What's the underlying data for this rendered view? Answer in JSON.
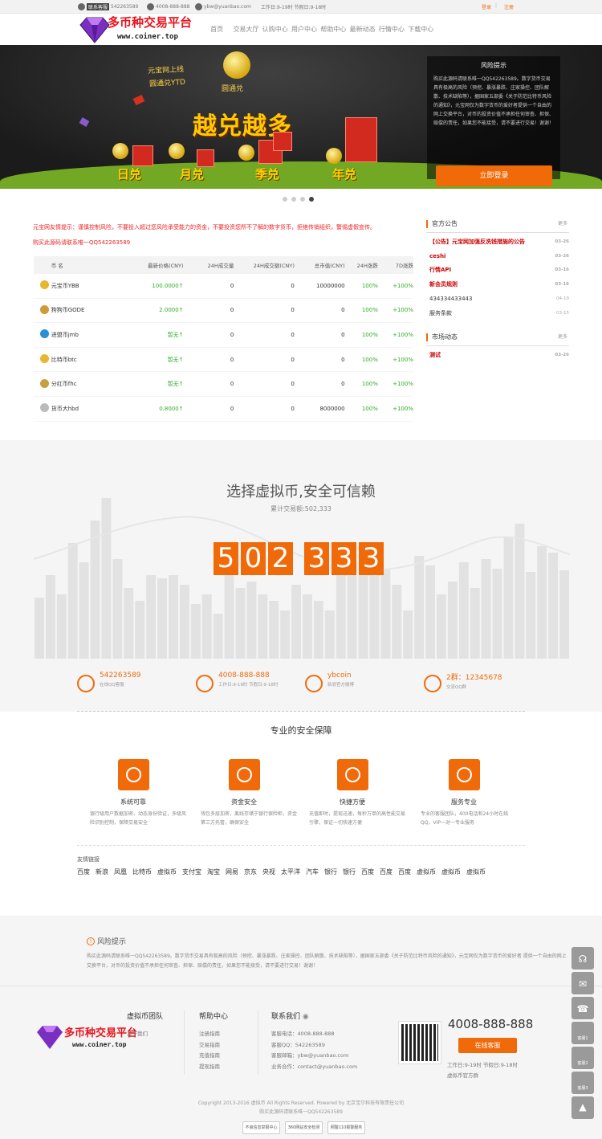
{
  "topbar": {
    "service": "联系客服",
    "qq": "542263589",
    "phone": "4008-888-888",
    "email": "ybw@yuanbao.com",
    "hours": "工作日:9-19时 节假日:9-18时",
    "login": "登录",
    "register": "注册"
  },
  "header": {
    "logo_text": "多币种交易平台",
    "logo_url": "www.coiner.top",
    "nav": [
      "首页",
      "交易大厅",
      "认购中心",
      "用户中心",
      "帮助中心",
      "最新动态",
      "行情中心",
      "下载中心"
    ]
  },
  "banner": {
    "line1": "元宝网上线",
    "line2": "圆通兑YTD",
    "coin_label": "圆通兑",
    "slogan": "越兑越多",
    "words": [
      "日兑",
      "月兑",
      "季兑",
      "年兑"
    ],
    "risk_title": "风险提示",
    "risk_text": "购买此源码请联系唯一QQ542263589。数字货币交易具有极高的风险（预挖、暴涨暴跌、庄家操控、团队解散、技术缺陷等），据国家五部委《关于防范比特币风险的通知》，元宝网仅为数字货币的爱好者提供一个自由的网上交换平台，对币的投资价值不承担任何审查、担保、赔偿的责任，如果您不能接受，请不要进行交易！谢谢！",
    "login": "立即登录"
  },
  "notice": {
    "text": "元宝网友情提示：谨慎控制风险，不要投入超过您风险承受能力的资金，不要投资您所不了解的数字货币，拒绝传销组织，警惕虚假宣传。",
    "contact": "购买此源码请联系唯一QQ542263589"
  },
  "market": {
    "headers": [
      "币 名",
      "最新价格(CNY)",
      "24H成交量",
      "24H成交额(CNY)",
      "总市值(CNY)",
      "24H涨跌",
      "7D涨跌"
    ],
    "rows": [
      {
        "name": "元宝币YBB",
        "price": "100.0000↑",
        "vol": "0",
        "amt": "0",
        "cap": "10000000",
        "d24": "100%",
        "d7": "+100%",
        "color": "#e8b730"
      },
      {
        "name": "狗狗币GODE",
        "price": "2.0000↑",
        "vol": "0",
        "amt": "0",
        "cap": "0",
        "d24": "100%",
        "d7": "+100%",
        "color": "#d09a3a"
      },
      {
        "name": "进盟币jmb",
        "price": "暂无↑",
        "vol": "0",
        "amt": "0",
        "cap": "0",
        "d24": "100%",
        "d7": "+100%",
        "color": "#2b8fd3"
      },
      {
        "name": "比特币btc",
        "price": "暂无↑",
        "vol": "0",
        "amt": "0",
        "cap": "0",
        "d24": "100%",
        "d7": "+100%",
        "color": "#e8b730"
      },
      {
        "name": "分红币fhc",
        "price": "暂无↑",
        "vol": "0",
        "amt": "0",
        "cap": "0",
        "d24": "100%",
        "d7": "+100%",
        "color": "#c9a040"
      },
      {
        "name": "货币大hbd",
        "price": "0.8000↑",
        "vol": "0",
        "amt": "0",
        "cap": "8000000",
        "d24": "100%",
        "d7": "+100%",
        "color": "#bbbbbb"
      }
    ]
  },
  "announce": {
    "title": "官方公告",
    "more": "更多",
    "items": [
      {
        "text": "【公告】元宝网加强反洗钱措施的公告",
        "date": "03-26",
        "red": true
      },
      {
        "text": "ceshi",
        "date": "03-26",
        "red": true
      },
      {
        "text": "行情API",
        "date": "03-16",
        "red": true
      },
      {
        "text": "新会员规则",
        "date": "03-16",
        "red": true
      },
      {
        "text": "434334433443",
        "date": "04-19",
        "red": false
      },
      {
        "text": "服务条款",
        "date": "03-15",
        "red": false
      }
    ]
  },
  "news": {
    "title": "市场动态",
    "more": "更多",
    "items": [
      {
        "text": "测试",
        "date": "03-26"
      }
    ]
  },
  "stats": {
    "title": "选择虚拟币,安全可信赖",
    "sub": "累计交易额:502,333",
    "digits": [
      "5",
      "0",
      "2",
      "3",
      "3",
      "3"
    ],
    "bars": [
      38,
      52,
      40,
      72,
      60,
      86,
      100,
      62,
      44,
      36,
      52,
      50,
      52,
      46,
      34,
      40,
      28,
      52,
      44,
      48,
      40,
      36,
      30,
      46,
      40,
      36,
      30,
      60,
      60,
      52,
      64,
      56,
      46,
      30,
      64,
      58,
      40,
      48,
      60,
      44,
      62,
      56,
      76,
      84,
      54,
      70,
      66,
      55
    ]
  },
  "contacts": [
    {
      "a": "542263589",
      "b": "在线QQ客服"
    },
    {
      "a": "4008-888-888",
      "b": "工作日:9-19时 节假日:9-18时"
    },
    {
      "a": "ybcoin",
      "b": "新浪官方微博"
    },
    {
      "a": "2群：12345678",
      "b": "交流QQ群"
    }
  ],
  "features": {
    "title": "专业的安全保障",
    "items": [
      {
        "t": "系统可靠",
        "d": "银行级用户数据加密、动态身份验证，多级风险识别控制，保障交易安全"
      },
      {
        "t": "资金安全",
        "d": "钱包多层加密，离线存储于银行保险柜，资金第三方托管，确保安全"
      },
      {
        "t": "快捷方便",
        "d": "充值即时，提现迅速，每秒万单的高性能交易引擎，保证一切快速方便"
      },
      {
        "t": "服务专业",
        "d": "专业的客服团队，400电话和24小时在线QQ，VIP一对一专业服务"
      }
    ]
  },
  "links": {
    "title": "友情链接",
    "items": [
      "百度",
      "新浪",
      "凤凰",
      "比特币",
      "虚拟币",
      "支付宝",
      "淘宝",
      "网易",
      "京东",
      "央视",
      "太平洋",
      "汽车",
      "银行",
      "银行",
      "百度",
      "百度",
      "百度",
      "虚拟币",
      "虚拟币",
      "虚拟币"
    ]
  },
  "frisk": {
    "title": "风险提示",
    "text": "购买此源码请联系唯一QQ542263589。数字货币交易具有极高的风险（预挖、暴涨暴跌、庄家操控、团队解散、技术缺陷等），据国家五部委《关于防范比特币风险的通知》，元宝网仅为数字货币的爱好者 提供一个自由的网上交换平台，对币的投资价值不承担任何审查、担保、赔偿的责任，如果您不能接受，请不要进行交易！谢谢！"
  },
  "footer": {
    "col1": {
      "h": "虚拟币团队",
      "l": [
        "关于我们"
      ]
    },
    "col2": {
      "h": "帮助中心",
      "l": [
        "注册指南",
        "交易指南",
        "充值指南",
        "提现指南"
      ]
    },
    "col3": {
      "h": "联系我们",
      "l": [
        "客服电话：4008-888-888",
        "客服QQ：542263589",
        "客服邮箱：ybw@yuanbao.com",
        "业务合作：contact@yuanbao.com"
      ]
    },
    "phone": "4008-888-888",
    "online": "在线客服",
    "work1": "工作日:9-19时 节假日:9-18时",
    "work2": "虚拟币官方群",
    "copy1": "Copyright 2013-2016 虚拟币 All Rights Reserved. Powered by 北京宝尔科技有限责任公司",
    "copy2": "购买此源码请联系唯一QQ542263589",
    "badges": [
      "不良信息举报中心",
      "360网站安全检测",
      "网警110报警服务"
    ]
  },
  "float": [
    "客服1",
    "客服2",
    "客服3"
  ]
}
